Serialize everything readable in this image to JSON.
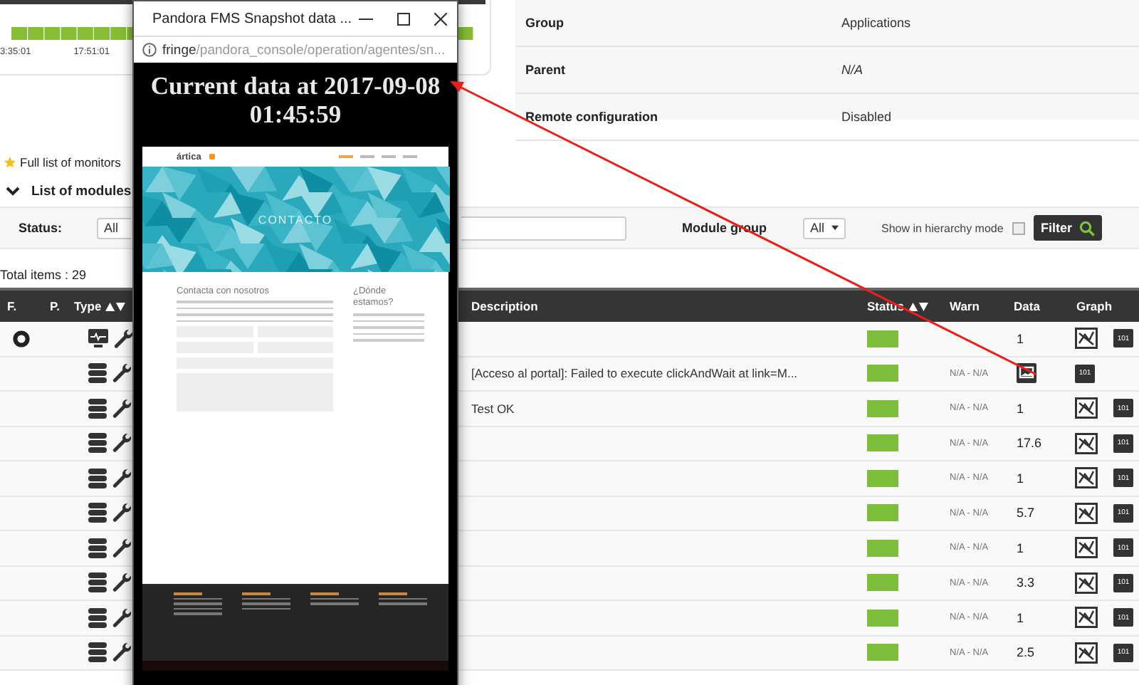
{
  "top_card": {
    "time_labels": [
      "3:35:01",
      "17:51:01"
    ]
  },
  "agent_info": [
    {
      "label": "Group",
      "value": "Applications",
      "italic": false
    },
    {
      "label": "Parent",
      "value": "N/A",
      "italic": true
    },
    {
      "label": "Remote configuration",
      "value": "Disabled",
      "italic": false
    }
  ],
  "monitors_title": "Full list of monitors",
  "modules_section": {
    "label": "List of modules",
    "expanded": true
  },
  "filter": {
    "status_label": "Status:",
    "status_value": "All",
    "module_group_label": "Module group",
    "module_group_value": "All",
    "hierarchy_label": "Show in hierarchy mode",
    "hierarchy_checked": false,
    "button": "Filter"
  },
  "total_items": "Total items : 29",
  "table": {
    "columns": [
      {
        "label": "F.",
        "sortable": false
      },
      {
        "label": "P.",
        "sortable": false
      },
      {
        "label": "Type",
        "sortable": true
      },
      {
        "label": "Description",
        "sortable": false
      },
      {
        "label": "Status",
        "sortable": true
      },
      {
        "label": "Warn",
        "sortable": false
      },
      {
        "label": "Data",
        "sortable": false
      },
      {
        "label": "Graph",
        "sortable": false
      }
    ],
    "rows": [
      {
        "flag": true,
        "kind": "monitor",
        "color": "#7dbf3c",
        "data": {
          "kind": "text",
          "text": "1"
        },
        "graph": true,
        "raw": "101"
      },
      {
        "flag": false,
        "kind": "database",
        "description": "[Acceso al portal]: Failed to execute clickAndWait at link=M...",
        "color": "#7dbf3c",
        "warn": "N/A - N/A",
        "data": {
          "kind": "image"
        },
        "graph": false,
        "raw": "101"
      },
      {
        "flag": false,
        "kind": "database",
        "description": "Test OK",
        "color": "#7dbf3c",
        "warn": "N/A - N/A",
        "data": {
          "kind": "text",
          "text": "1"
        },
        "graph": true,
        "raw": "101"
      },
      {
        "flag": false,
        "kind": "database",
        "color": "#7dbf3c",
        "warn": "N/A - N/A",
        "data": {
          "kind": "text",
          "text": "17.6"
        },
        "graph": true,
        "raw": "101"
      },
      {
        "flag": false,
        "kind": "database",
        "color": "#7dbf3c",
        "warn": "N/A - N/A",
        "data": {
          "kind": "text",
          "text": "1"
        },
        "graph": true,
        "raw": "101"
      },
      {
        "flag": false,
        "kind": "database",
        "color": "#7dbf3c",
        "warn": "N/A - N/A",
        "data": {
          "kind": "text",
          "text": "5.7"
        },
        "graph": true,
        "raw": "101"
      },
      {
        "flag": false,
        "kind": "database",
        "color": "#7dbf3c",
        "warn": "N/A - N/A",
        "data": {
          "kind": "text",
          "text": "1"
        },
        "graph": true,
        "raw": "101"
      },
      {
        "flag": false,
        "kind": "database",
        "color": "#7dbf3c",
        "warn": "N/A - N/A",
        "data": {
          "kind": "text",
          "text": "3.3"
        },
        "graph": true,
        "raw": "101"
      },
      {
        "flag": false,
        "kind": "database",
        "color": "#7dbf3c",
        "warn": "N/A - N/A",
        "data": {
          "kind": "text",
          "text": "1"
        },
        "graph": true,
        "raw": "101"
      },
      {
        "flag": false,
        "kind": "database",
        "color": "#7dbf3c",
        "warn": "N/A - N/A",
        "data": {
          "kind": "text",
          "text": "2.5"
        },
        "graph": true,
        "raw": "101"
      }
    ]
  },
  "popup": {
    "title": "Pandora FMS Snapshot data ...",
    "url_host": "fringe",
    "url_path": "/pandora_console/operation/agentes/sn...",
    "heading": "Current data at 2017-09-08 01:45:59",
    "snapshot": {
      "logo": "ártica",
      "banner": "CONTACTO",
      "form_title": "Contacta con nosotros",
      "side_title": "¿Dónde estamos?"
    }
  }
}
